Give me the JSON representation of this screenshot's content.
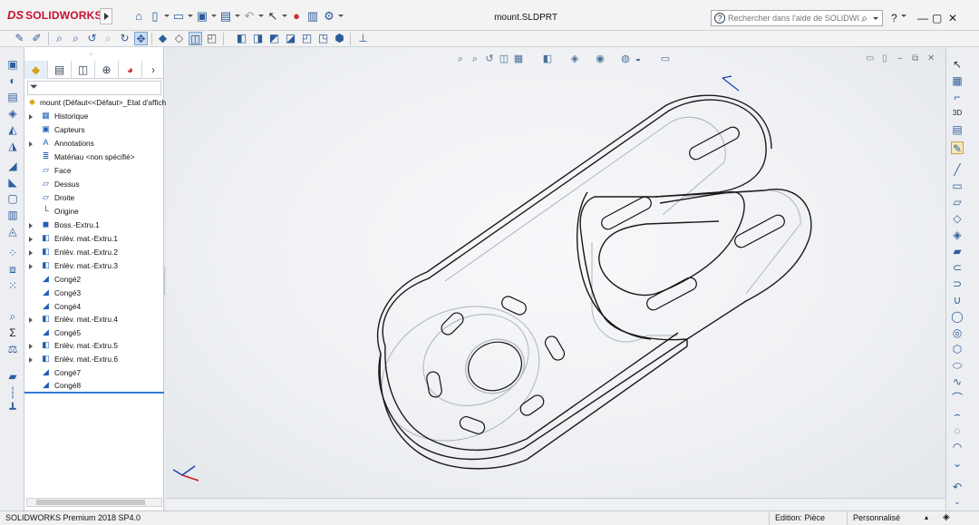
{
  "app": {
    "brand_ds": "DS",
    "brand_name": "SOLIDWORKS",
    "document_title": "mount.SLDPRT"
  },
  "help_search": {
    "placeholder": "Rechercher dans l'aide de SOLIDWORKS",
    "help_glyph": "?"
  },
  "title_icons": [
    "home-icon",
    "new-document-icon",
    "open-icon",
    "save-icon",
    "print-icon",
    "undo-icon",
    "select-icon",
    "rebuild-icon",
    "file-properties-icon",
    "options-icon"
  ],
  "window_buttons": [
    "?",
    "—",
    "▢",
    "✕"
  ],
  "feature_tree": {
    "root_label": "mount  (Défaut<<Défaut>_Etat d'afficha",
    "items": [
      {
        "label": "Historique",
        "icon": "history-icon",
        "expandable": true
      },
      {
        "label": "Capteurs",
        "icon": "sensor-icon",
        "expandable": false
      },
      {
        "label": "Annotations",
        "icon": "annotations-icon",
        "expandable": true
      },
      {
        "label": "Matériau <non spécifié>",
        "icon": "material-icon",
        "expandable": false
      },
      {
        "label": "Face",
        "icon": "plane-icon",
        "expandable": false
      },
      {
        "label": "Dessus",
        "icon": "plane-icon",
        "expandable": false
      },
      {
        "label": "Droite",
        "icon": "plane-icon",
        "expandable": false
      },
      {
        "label": "Origine",
        "icon": "origin-icon",
        "expandable": false
      },
      {
        "label": "Boss.-Extru.1",
        "icon": "boss-extrude-icon",
        "expandable": true
      },
      {
        "label": "Enlèv. mat.-Extru.1",
        "icon": "cut-extrude-icon",
        "expandable": true
      },
      {
        "label": "Enlèv. mat.-Extru.2",
        "icon": "cut-extrude-icon",
        "expandable": true
      },
      {
        "label": "Enlèv. mat.-Extru.3",
        "icon": "cut-extrude-icon",
        "expandable": true
      },
      {
        "label": "Congé2",
        "icon": "fillet-icon",
        "expandable": false
      },
      {
        "label": "Congé3",
        "icon": "fillet-icon",
        "expandable": false
      },
      {
        "label": "Congé4",
        "icon": "fillet-icon",
        "expandable": false
      },
      {
        "label": "Enlèv. mat.-Extru.4",
        "icon": "cut-extrude-icon",
        "expandable": true
      },
      {
        "label": "Congé5",
        "icon": "fillet-icon",
        "expandable": false
      },
      {
        "label": "Enlèv. mat.-Extru.5",
        "icon": "cut-extrude-icon",
        "expandable": true
      },
      {
        "label": "Enlèv. mat.-Extru.6",
        "icon": "cut-extrude-icon",
        "expandable": true
      },
      {
        "label": "Congé7",
        "icon": "fillet-icon",
        "expandable": false
      },
      {
        "label": "Congé8",
        "icon": "fillet-icon",
        "expandable": false
      }
    ]
  },
  "status_bar": {
    "version": "SOLIDWORKS Premium 2018 SP4.0",
    "mode": "Edition: Pièce",
    "units": "Personnalisé"
  },
  "colors": {
    "brand_red": "#c8102e",
    "accent_blue": "#2f7bd6",
    "viewport_bg": "#eef0f3"
  }
}
